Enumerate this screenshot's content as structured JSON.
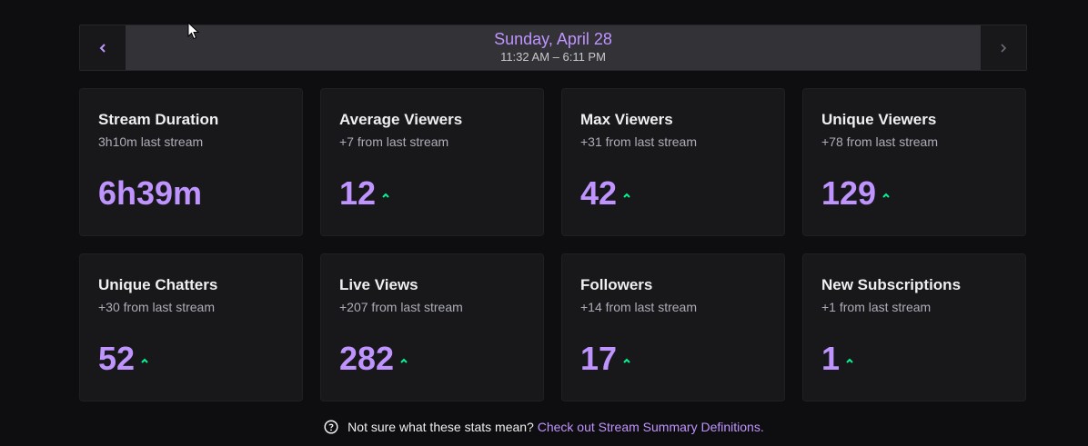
{
  "date_nav": {
    "title": "Sunday, April 28",
    "range": "11:32 AM – 6:11 PM",
    "prev_icon": "chevron-left-icon",
    "next_icon": "chevron-right-icon"
  },
  "cards": [
    {
      "title": "Stream Duration",
      "sub": "3h10m last stream",
      "value": "6h39m",
      "trend": "none"
    },
    {
      "title": "Average Viewers",
      "sub": "+7 from last stream",
      "value": "12",
      "trend": "up"
    },
    {
      "title": "Max Viewers",
      "sub": "+31 from last stream",
      "value": "42",
      "trend": "up"
    },
    {
      "title": "Unique Viewers",
      "sub": "+78 from last stream",
      "value": "129",
      "trend": "up"
    },
    {
      "title": "Unique Chatters",
      "sub": "+30 from last stream",
      "value": "52",
      "trend": "up"
    },
    {
      "title": "Live Views",
      "sub": "+207 from last stream",
      "value": "282",
      "trend": "up"
    },
    {
      "title": "Followers",
      "sub": "+14 from last stream",
      "value": "17",
      "trend": "up"
    },
    {
      "title": "New Subscriptions",
      "sub": "+1 from last stream",
      "value": "1",
      "trend": "up"
    }
  ],
  "footer": {
    "text": "Not sure what these stats mean?",
    "link": "Check out Stream Summary Definitions."
  },
  "colors": {
    "accent": "#bf94ff",
    "trend_up": "#00f593",
    "background": "#0e0e10",
    "card": "#18181b"
  }
}
